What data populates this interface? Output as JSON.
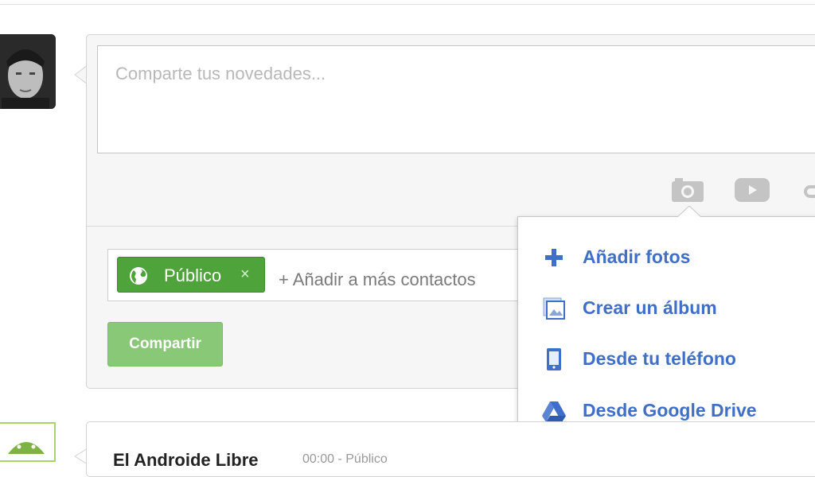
{
  "composer": {
    "placeholder": "Comparte tus novedades...",
    "audience_chip": "Público",
    "chip_remove": "×",
    "add_contacts": "+ Añadir a más contactos",
    "share_button": "Compartir"
  },
  "media_buttons": [
    "camera-icon",
    "video-icon",
    "link-icon"
  ],
  "photo_menu": {
    "items": [
      {
        "label": "Añadir fotos",
        "icon": "plus-icon"
      },
      {
        "label": "Crear un álbum",
        "icon": "album-icon"
      },
      {
        "label": "Desde tu teléfono",
        "icon": "phone-icon"
      },
      {
        "label": "Desde Google Drive",
        "icon": "google-drive-icon"
      }
    ]
  },
  "next_post": {
    "author": "El Androide Libre",
    "time": "00:00 - Público"
  },
  "colors": {
    "chip_green": "#4ea33a",
    "button_green": "#88c877",
    "menu_link_blue": "#3f6fc9",
    "placeholder_gray": "#b8b8b8"
  }
}
